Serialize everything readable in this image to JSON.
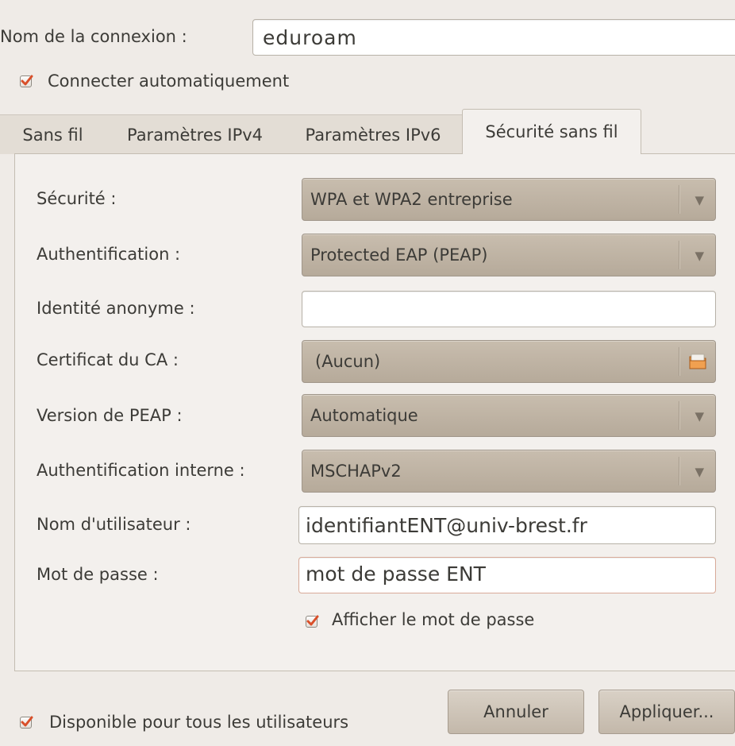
{
  "connection": {
    "name_label": "Nom de la connexion :",
    "name_value": "eduroam",
    "auto_connect_label": "Connecter automatiquement",
    "auto_connect_checked": true
  },
  "tabs": [
    {
      "label": "Sans fil",
      "active": false
    },
    {
      "label": "Paramètres IPv4",
      "active": false
    },
    {
      "label": "Paramètres IPv6",
      "active": false
    },
    {
      "label": "Sécurité sans fil",
      "active": true
    }
  ],
  "security": {
    "security_label": "Sécurité :",
    "security_value": "WPA et WPA2 entreprise",
    "auth_label": "Authentification :",
    "auth_value": "Protected EAP (PEAP)",
    "anon_identity_label": "Identité anonyme :",
    "anon_identity_value": "",
    "ca_cert_label": "Certificat du CA :",
    "ca_cert_value": "(Aucun)",
    "peap_version_label": "Version de PEAP :",
    "peap_version_value": "Automatique",
    "inner_auth_label": "Authentification interne :",
    "inner_auth_value": "MSCHAPv2",
    "username_label": "Nom d'utilisateur :",
    "username_value": "identifiantENT@univ-brest.fr",
    "password_label": "Mot de passe :",
    "password_value": "mot de passe ENT",
    "show_password_label": "Afficher le mot de passe",
    "show_password_checked": true
  },
  "footer": {
    "all_users_label": "Disponible pour tous les utilisateurs",
    "all_users_checked": true,
    "cancel_label": "Annuler",
    "apply_label": "Appliquer..."
  },
  "icons": {
    "dropdown": "triangle-down-icon",
    "file_chooser": "folder-icon",
    "check": "check-icon"
  },
  "colors": {
    "background": "#efebe7",
    "combo": "#bfb3a3",
    "check_accent": "#d94f2a"
  }
}
